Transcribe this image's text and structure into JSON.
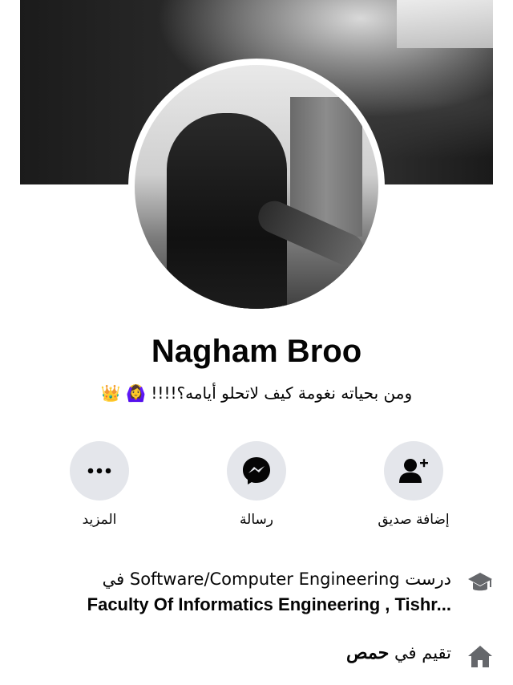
{
  "profile": {
    "name": "Nagham Broo",
    "bio": "ومن بحياته نغومة كيف لاتحلو أيامه؟!!!! 🙆‍♀️ 👑"
  },
  "actions": [
    {
      "label": "إضافة صديق",
      "icon": "add-friend-icon"
    },
    {
      "label": "رسالة",
      "icon": "messenger-icon"
    },
    {
      "label": "المزيد",
      "icon": "more-icon"
    }
  ],
  "info": {
    "education_prefix": "درست",
    "education_field": "Software/Computer Engineering",
    "education_in": "في",
    "education_school": "Faculty Of Informatics Engineering , Tishr...",
    "lives_prefix": "تقيم في",
    "lives_city": "حمص"
  }
}
